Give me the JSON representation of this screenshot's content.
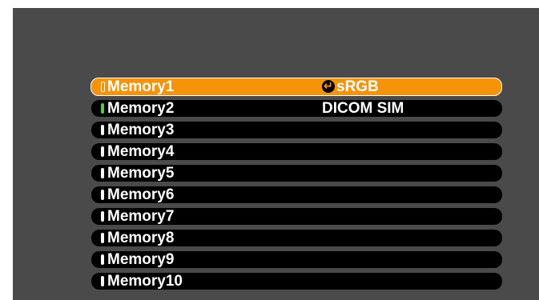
{
  "menu": {
    "items": [
      {
        "label": "Memory1",
        "selected": true,
        "indicator": "empty",
        "option": "sRGB",
        "option_icon": "enter-icon"
      },
      {
        "label": "Memory2",
        "selected": false,
        "indicator": "green",
        "option": "DICOM SIM"
      },
      {
        "label": "Memory3",
        "selected": false,
        "indicator": "white"
      },
      {
        "label": "Memory4",
        "selected": false,
        "indicator": "white"
      },
      {
        "label": "Memory5",
        "selected": false,
        "indicator": "white"
      },
      {
        "label": "Memory6",
        "selected": false,
        "indicator": "white"
      },
      {
        "label": "Memory7",
        "selected": false,
        "indicator": "white"
      },
      {
        "label": "Memory8",
        "selected": false,
        "indicator": "white"
      },
      {
        "label": "Memory9",
        "selected": false,
        "indicator": "white"
      },
      {
        "label": "Memory10",
        "selected": false,
        "indicator": "white"
      }
    ]
  },
  "colors": {
    "panel_bg": "#4a4a4a",
    "row_bg": "#000000",
    "highlight": "#f5930b",
    "active_indicator": "#4cd137",
    "text": "#ffffff"
  }
}
